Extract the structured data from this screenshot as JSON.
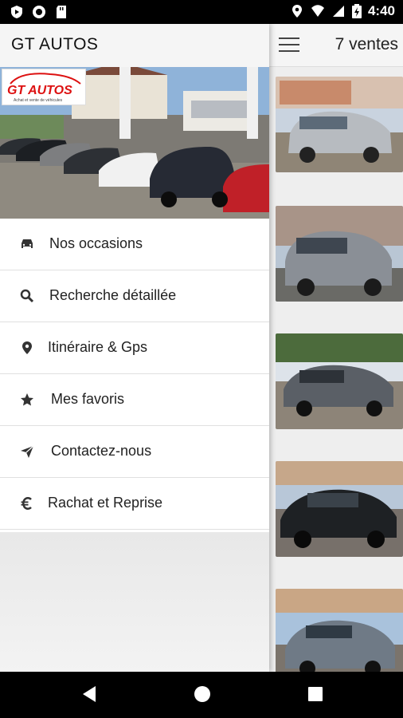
{
  "status_bar": {
    "time": "4:40"
  },
  "app": {
    "title": "GT AUTOS"
  },
  "hero": {
    "logo_text": "GT AUTOS",
    "logo_subtitle": "Achat et vente de véhicules"
  },
  "menu": {
    "items": [
      {
        "label": "Nos occasions",
        "icon": "car-icon"
      },
      {
        "label": "Recherche détaillée",
        "icon": "search-icon"
      },
      {
        "label": "Itinéraire & Gps",
        "icon": "location-pin-icon"
      },
      {
        "label": "Mes favoris",
        "icon": "star-icon"
      },
      {
        "label": "Contactez-nous",
        "icon": "send-icon"
      },
      {
        "label": "Rachat et Reprise",
        "icon": "euro-icon"
      }
    ]
  },
  "listing": {
    "count_label": "7 ventes"
  },
  "cars": [
    {
      "color": "#b7bbc0"
    },
    {
      "color": "#8a8f96"
    },
    {
      "color": "#5a5f66"
    },
    {
      "color": "#1e2124"
    },
    {
      "color": "#6f7a86"
    }
  ]
}
